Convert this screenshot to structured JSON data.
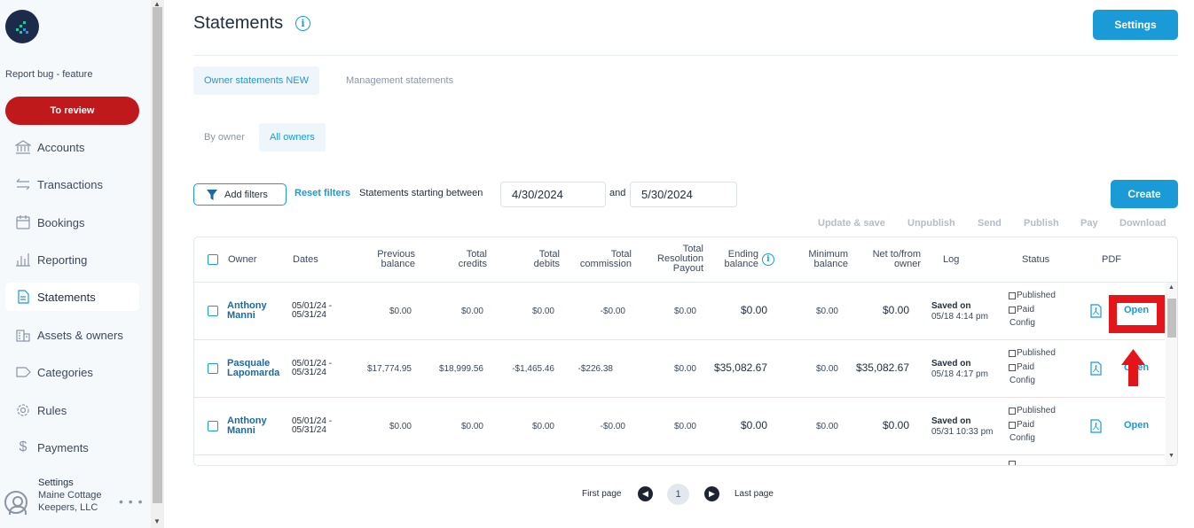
{
  "sidebar": {
    "report_bug": "Report bug - feature",
    "to_review": "To review",
    "items": [
      {
        "label": "Accounts",
        "icon": "bank-icon"
      },
      {
        "label": "Transactions",
        "icon": "arrows-swap-icon"
      },
      {
        "label": "Bookings",
        "icon": "calendar-icon"
      },
      {
        "label": "Reporting",
        "icon": "bar-chart-icon"
      },
      {
        "label": "Statements",
        "icon": "document-icon"
      },
      {
        "label": "Assets & owners",
        "icon": "building-icon"
      },
      {
        "label": "Categories",
        "icon": "tag-icon"
      },
      {
        "label": "Rules",
        "icon": "gear-icon"
      },
      {
        "label": "Payments",
        "icon": "dollar-icon"
      }
    ],
    "active": "Statements",
    "user": {
      "settings_label": "Settings",
      "company": "Maine Cottage Keepers, LLC"
    }
  },
  "header": {
    "title": "Statements",
    "settings_button": "Settings"
  },
  "tabs": {
    "owner_statements": "Owner statements NEW",
    "management_statements": "Management statements"
  },
  "subtabs": {
    "by_owner": "By owner",
    "all_owners": "All owners"
  },
  "filters": {
    "add_filters": "Add filters",
    "reset_filters": "Reset filters",
    "label": "Statements starting between",
    "start_date": "4/30/2024",
    "and_label": "and",
    "end_date": "5/30/2024",
    "create_button": "Create"
  },
  "actions": [
    "Update & save",
    "Unpublish",
    "Send",
    "Publish",
    "Pay",
    "Download"
  ],
  "table": {
    "headers": {
      "owner": "Owner",
      "dates": "Dates",
      "previous_balance": [
        "Previous",
        "balance"
      ],
      "total_credits": [
        "Total",
        "credits"
      ],
      "total_debits": [
        "Total",
        "debits"
      ],
      "total_commission": [
        "Total",
        "commission"
      ],
      "total_resolution": [
        "Total",
        "Resolution",
        "Payout"
      ],
      "ending_balance": [
        "Ending",
        "balance"
      ],
      "minimum_balance": [
        "Minimum",
        "balance"
      ],
      "net": [
        "Net to/from",
        "owner"
      ],
      "log": "Log",
      "status": "Status",
      "pdf": "PDF"
    },
    "status_labels": {
      "published": "Published",
      "paid": "Paid",
      "config": "Config"
    },
    "open_label": "Open",
    "rows": [
      {
        "owner": [
          "Anthony",
          "Manni"
        ],
        "dates": [
          "05/01/24 -",
          "05/31/24"
        ],
        "previous": "$0.00",
        "credits": "$0.00",
        "debits": "$0.00",
        "commission": "-$0.00",
        "resolution": "$0.00",
        "ending": "$0.00",
        "minimum": "$0.00",
        "net": "$0.00",
        "saved_on": "Saved on",
        "saved_time": "05/18 4:14 pm"
      },
      {
        "owner": [
          "Pasquale",
          "Lapomarda"
        ],
        "dates": [
          "05/01/24 -",
          "05/31/24"
        ],
        "previous": "$17,774.95",
        "credits": "$18,999.56",
        "debits": "-$1,465.46",
        "commission": "-$226.38",
        "resolution": "$0.00",
        "ending": "$35,082.67",
        "minimum": "$0.00",
        "net": "$35,082.67",
        "saved_on": "Saved on",
        "saved_time": "05/18 4:17 pm"
      },
      {
        "owner": [
          "Anthony",
          "Manni"
        ],
        "dates": [
          "05/01/24 -",
          "05/31/24"
        ],
        "previous": "$0.00",
        "credits": "$0.00",
        "debits": "$0.00",
        "commission": "-$0.00",
        "resolution": "$0.00",
        "ending": "$0.00",
        "minimum": "$0.00",
        "net": "$0.00",
        "saved_on": "Saved on",
        "saved_time": "05/31 10:33 pm"
      }
    ]
  },
  "pagination": {
    "first": "First page",
    "current": "1",
    "last": "Last page"
  },
  "colors": {
    "accent": "#1a9ad6",
    "review": "#c0191c",
    "highlight": "#e3151a",
    "sidebar_bg": "#f5f9fc"
  }
}
